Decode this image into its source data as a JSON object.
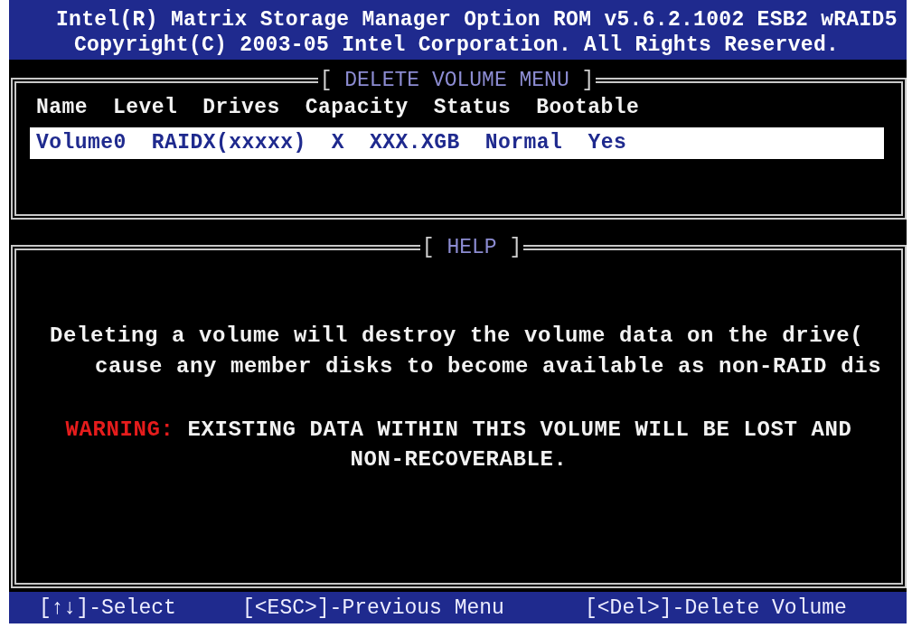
{
  "header": {
    "title": "Intel(R) Matrix Storage Manager Option ROM v5.6.2.1002 ESB2 wRAID5",
    "copyright": "Copyright(C) 2003-05 Intel Corporation. All Rights Reserved."
  },
  "volume_panel": {
    "title": {
      "open": "[",
      "text": "DELETE VOLUME MENU",
      "close": "]"
    },
    "header_labels": [
      "Name",
      "Level",
      "Drives",
      "Capacity",
      "Status",
      "Bootable"
    ],
    "volumes": [
      {
        "name": "Volume0",
        "level": "RAIDX(xxxxx)",
        "drives": "X",
        "capacity": "XXX.XGB",
        "status": "Normal",
        "bootable": "Yes",
        "selected": true
      }
    ]
  },
  "help_panel": {
    "title": {
      "open": "[",
      "text": "HELP",
      "close": "]"
    },
    "message_lines": [
      "Deleting a volume will destroy the volume data on the drive(",
      "cause any member disks to become available as non-RAID dis"
    ],
    "warning": {
      "label": "WARNING:",
      "lines": [
        "EXISTING DATA WITHIN THIS VOLUME WILL BE LOST AND",
        "NON-RECOVERABLE."
      ]
    }
  },
  "status_bar": [
    {
      "label": "[↑↓]-Select"
    },
    {
      "label": "[<ESC>]-Previous Menu"
    },
    {
      "label": "[<Del>]-Delete Volume"
    }
  ]
}
